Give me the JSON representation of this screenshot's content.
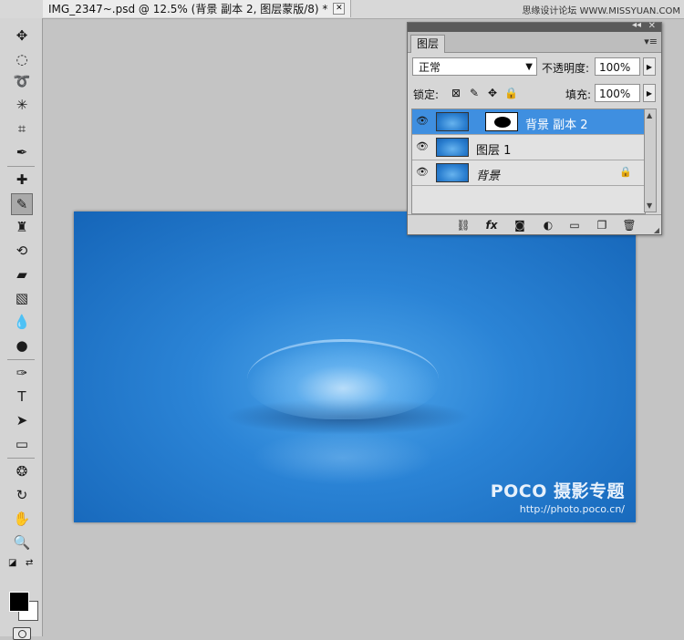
{
  "document": {
    "tab_title": "IMG_2347~.psd @ 12.5% (背景 副本 2, 图层蒙版/8) *",
    "close_glyph": "✕"
  },
  "site_watermark": "思缘设计论坛 WWW.MISSYUAN.COM",
  "canvas": {
    "brand": "POCO 摄影专题",
    "url": "http://photo.poco.cn/"
  },
  "tools": [
    {
      "name": "move-tool",
      "glyph": "✥"
    },
    {
      "name": "marquee-tool",
      "glyph": "◌"
    },
    {
      "name": "lasso-tool",
      "glyph": "➰"
    },
    {
      "name": "magic-wand-tool",
      "glyph": "✳"
    },
    {
      "name": "crop-tool",
      "glyph": "⌗"
    },
    {
      "name": "eyedropper-tool",
      "glyph": "✒"
    },
    {
      "name": "healing-brush-tool",
      "glyph": "✚"
    },
    {
      "name": "brush-tool",
      "glyph": "✎"
    },
    {
      "name": "clone-stamp-tool",
      "glyph": "♜"
    },
    {
      "name": "history-brush-tool",
      "glyph": "⟲"
    },
    {
      "name": "eraser-tool",
      "glyph": "▰"
    },
    {
      "name": "gradient-tool",
      "glyph": "▧"
    },
    {
      "name": "blur-tool",
      "glyph": "💧"
    },
    {
      "name": "dodge-tool",
      "glyph": "●"
    },
    {
      "name": "pen-tool",
      "glyph": "✑"
    },
    {
      "name": "type-tool",
      "glyph": "T"
    },
    {
      "name": "path-selection-tool",
      "glyph": "➤"
    },
    {
      "name": "shape-tool",
      "glyph": "▭"
    },
    {
      "name": "3d-rotate-tool",
      "glyph": "❂"
    },
    {
      "name": "3d-orbit-tool",
      "glyph": "↻"
    },
    {
      "name": "hand-tool",
      "glyph": "✋"
    },
    {
      "name": "zoom-tool",
      "glyph": "🔍"
    }
  ],
  "layers_panel": {
    "tab_label": "图层",
    "collapse_glyph": "◂◂",
    "close_glyph": "✕",
    "menu_glyph": "▾≡",
    "blend_mode": "正常",
    "opacity_label": "不透明度:",
    "opacity_value": "100%",
    "lock_label": "锁定:",
    "fill_label": "填充:",
    "fill_value": "100%",
    "layers": [
      {
        "name": "背景 副本 2",
        "selected": true,
        "has_mask": true,
        "locked": false
      },
      {
        "name": "图层 1",
        "selected": false,
        "has_mask": false,
        "locked": false
      },
      {
        "name": "背景",
        "selected": false,
        "has_mask": false,
        "locked": true
      }
    ]
  },
  "colors": {
    "accent_selected": "#3f8fe0",
    "foreground": "#000000",
    "background": "#ffffff"
  }
}
